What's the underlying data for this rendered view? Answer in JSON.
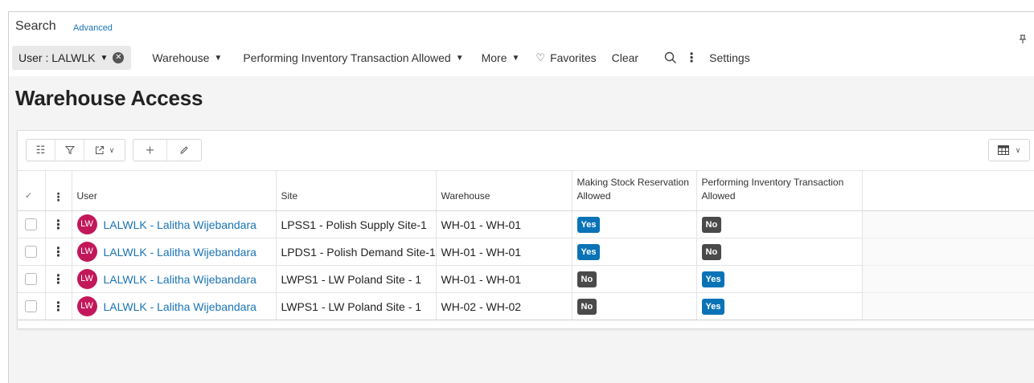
{
  "search": {
    "title": "Search",
    "advanced_label": "Advanced",
    "filters": {
      "user_chip": "User : LALWLK",
      "warehouse": "Warehouse",
      "performing": "Performing Inventory Transaction Allowed",
      "more": "More",
      "favorites": "Favorites",
      "clear": "Clear",
      "settings": "Settings"
    }
  },
  "page": {
    "title": "Warehouse Access"
  },
  "table": {
    "columns": {
      "user": "User",
      "site": "Site",
      "warehouse": "Warehouse",
      "making_stock": "Making Stock Reservation Allowed",
      "performing": "Performing Inventory Transaction Allowed"
    },
    "rows": [
      {
        "avatar": "LW",
        "user": "LALWLK - Lalitha Wijebandara",
        "site": "LPSS1 - Polish Supply Site-1",
        "warehouse": "WH-01 - WH-01",
        "making_stock": "Yes",
        "performing": "No"
      },
      {
        "avatar": "LW",
        "user": "LALWLK - Lalitha Wijebandara",
        "site": "LPDS1 - Polish Demand Site-1",
        "warehouse": "WH-01 - WH-01",
        "making_stock": "Yes",
        "performing": "No"
      },
      {
        "avatar": "LW",
        "user": "LALWLK - Lalitha Wijebandara",
        "site": "LWPS1 - LW Poland Site - 1",
        "warehouse": "WH-01 - WH-01",
        "making_stock": "No",
        "performing": "Yes"
      },
      {
        "avatar": "LW",
        "user": "LALWLK - Lalitha Wijebandara",
        "site": "LWPS1 - LW Poland Site - 1",
        "warehouse": "WH-02 - WH-02",
        "making_stock": "No",
        "performing": "Yes"
      }
    ]
  },
  "colors": {
    "accent": "#1a73b5",
    "yes_badge": "#0a73b7",
    "no_badge": "#4a4a4a",
    "avatar": "#c2185b"
  }
}
